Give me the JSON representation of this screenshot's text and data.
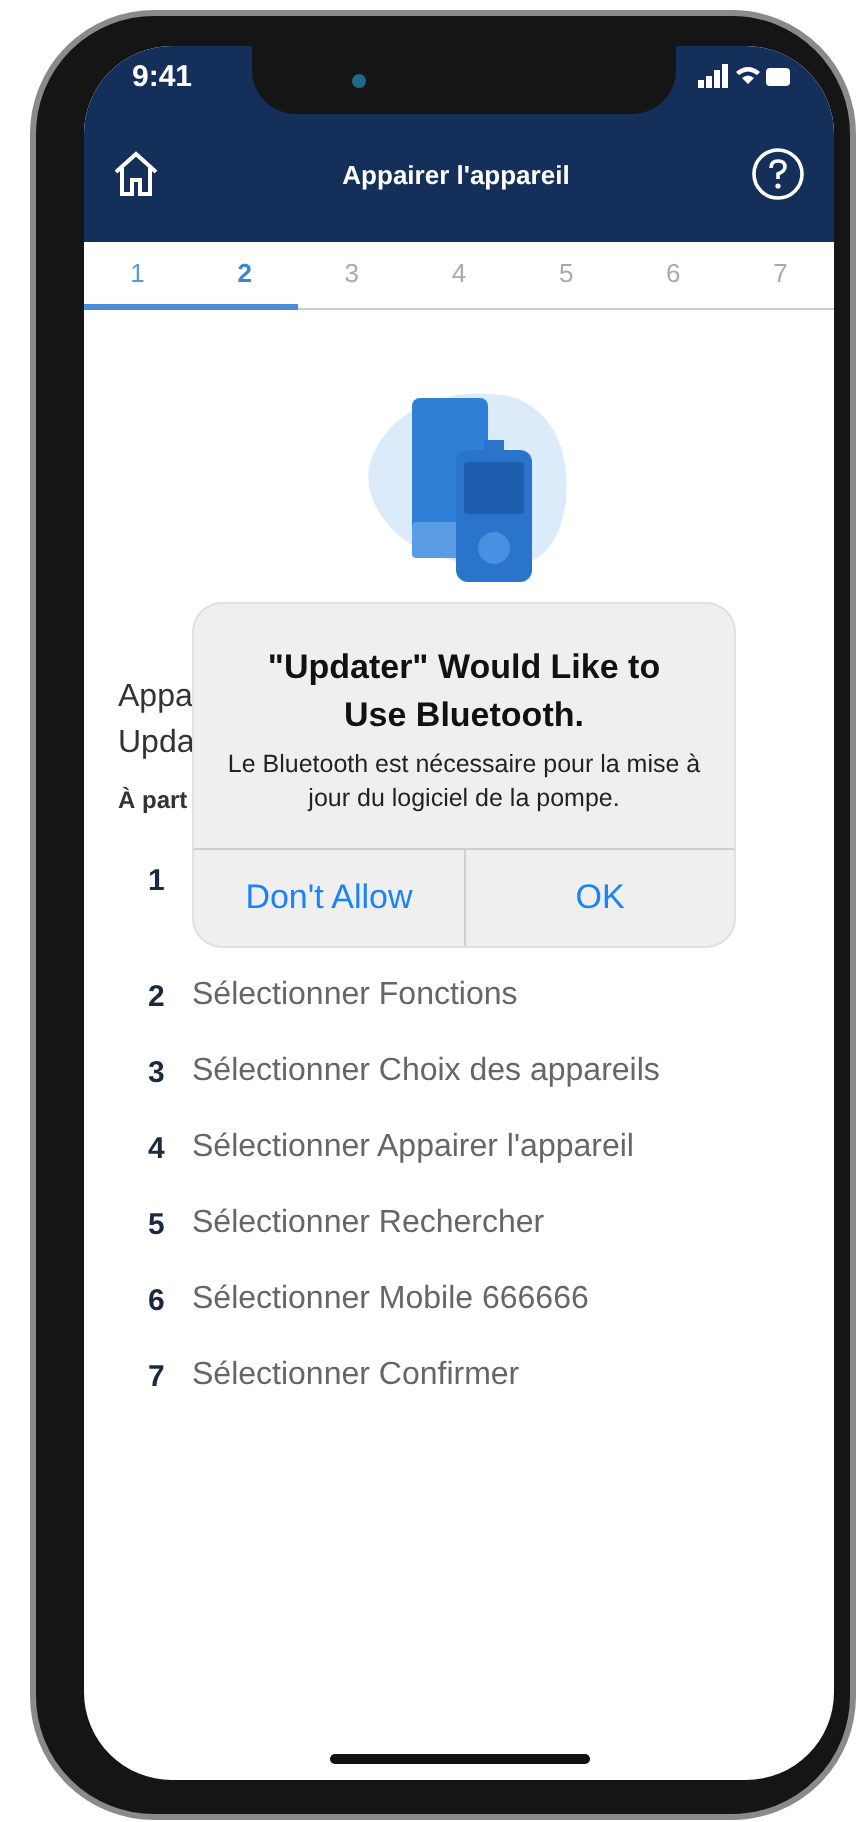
{
  "status_bar": {
    "time": "9:41"
  },
  "header": {
    "title": "Appairer l'appareil"
  },
  "tabs": [
    {
      "label": "1",
      "selected": false,
      "completed": true
    },
    {
      "label": "2",
      "selected": true,
      "completed": false
    },
    {
      "label": "3",
      "selected": false,
      "completed": false
    },
    {
      "label": "4",
      "selected": false,
      "completed": false
    },
    {
      "label": "5",
      "selected": false,
      "completed": false
    },
    {
      "label": "6",
      "selected": false,
      "completed": false
    },
    {
      "label": "7",
      "selected": false,
      "completed": false
    }
  ],
  "content": {
    "heading_lines": [
      "Appa",
      "Upda"
    ],
    "intro": "À part",
    "steps": [
      {
        "number": "1"
      },
      {
        "number": "2",
        "text": "Sélectionner Fonctions"
      },
      {
        "number": "3",
        "text": "Sélectionner Choix des appareils"
      },
      {
        "number": "4",
        "text": "Sélectionner Appairer l'appareil"
      },
      {
        "number": "5",
        "text": "Sélectionner Rechercher"
      },
      {
        "number": "6",
        "text": "Sélectionner Mobile 666666"
      },
      {
        "number": "7",
        "text": "Sélectionner Confirmer"
      }
    ]
  },
  "alert": {
    "title": "\"Updater\" Would Like to Use Bluetooth.",
    "message": "Le Bluetooth est nécessaire pour la mise à jour du logiciel de la pompe.",
    "buttons": [
      "Don't Allow",
      "OK"
    ]
  }
}
